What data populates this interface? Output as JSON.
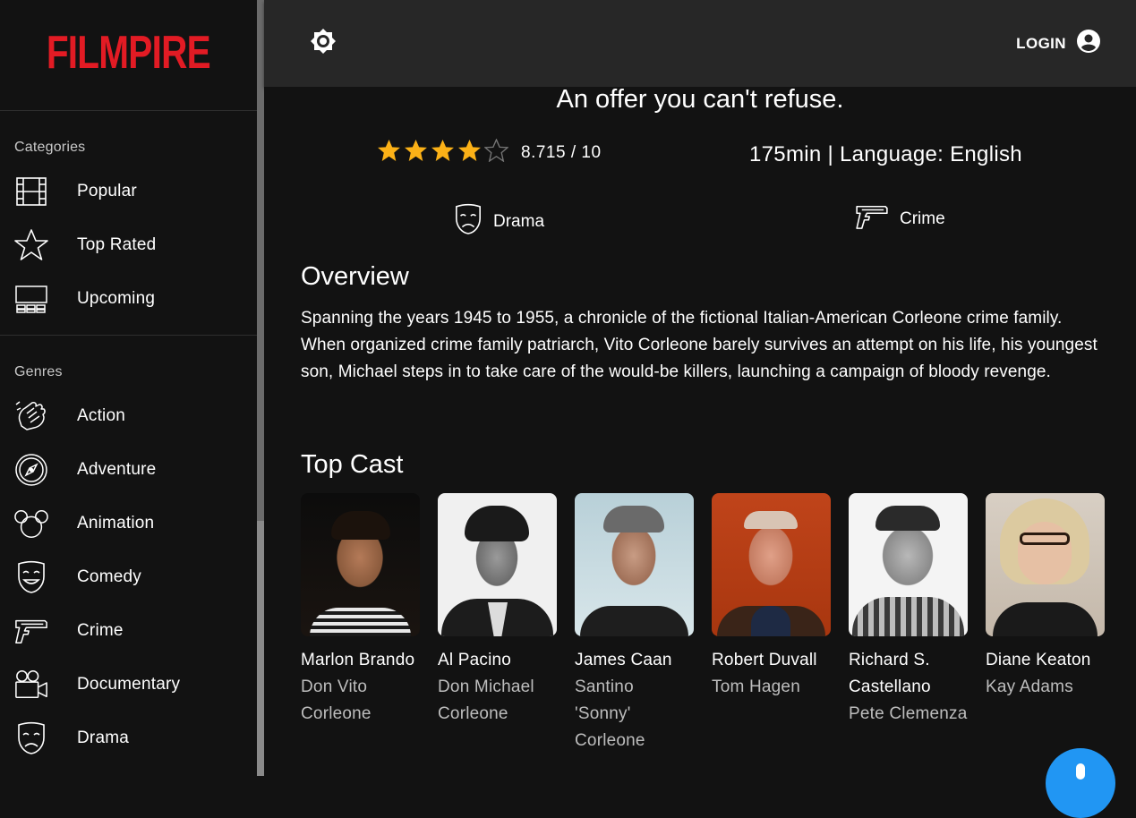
{
  "app": {
    "logo": "FILMPIRE"
  },
  "sidebar": {
    "categories_title": "Categories",
    "categories": [
      {
        "label": "Popular",
        "icon": "film-strip-icon"
      },
      {
        "label": "Top Rated",
        "icon": "star-outline-icon"
      },
      {
        "label": "Upcoming",
        "icon": "cinema-screen-icon"
      }
    ],
    "genres_title": "Genres",
    "genres": [
      {
        "label": "Action",
        "icon": "fist-icon"
      },
      {
        "label": "Adventure",
        "icon": "compass-icon"
      },
      {
        "label": "Animation",
        "icon": "mouse-ears-icon"
      },
      {
        "label": "Comedy",
        "icon": "comedy-mask-icon"
      },
      {
        "label": "Crime",
        "icon": "pistol-icon"
      },
      {
        "label": "Documentary",
        "icon": "camera-icon"
      },
      {
        "label": "Drama",
        "icon": "drama-mask-icon"
      }
    ]
  },
  "topbar": {
    "login_label": "LOGIN"
  },
  "movie": {
    "tagline": "An offer you can't refuse.",
    "rating": 8.715,
    "rating_text": "8.715 / 10",
    "stars_filled": 4,
    "stars_total": 5,
    "meta": "175min | Language: English",
    "genres": [
      {
        "label": "Drama",
        "icon": "drama-mask-icon"
      },
      {
        "label": "Crime",
        "icon": "pistol-icon"
      }
    ],
    "overview_title": "Overview",
    "overview": "Spanning the years 1945 to 1955, a chronicle of the fictional Italian-American Corleone crime family. When organized crime family patriarch, Vito Corleone barely survives an attempt on his life, his youngest son, Michael steps in to take care of the would-be killers, launching a campaign of bloody revenge.",
    "cast_title": "Top Cast",
    "cast": [
      {
        "name": "Marlon Brando",
        "character": "Don Vito Corleone"
      },
      {
        "name": "Al Pacino",
        "character": "Don Michael Corleone"
      },
      {
        "name": "James Caan",
        "character": "Santino 'Sonny' Corleone"
      },
      {
        "name": "Robert Duvall",
        "character": "Tom Hagen"
      },
      {
        "name": "Richard S. Castellano",
        "character": "Pete Clemenza"
      },
      {
        "name": "Diane Keaton",
        "character": "Kay Adams"
      }
    ]
  },
  "colors": {
    "brand": "#e21b24",
    "star": "#fbb117",
    "fab": "#2196f3"
  }
}
